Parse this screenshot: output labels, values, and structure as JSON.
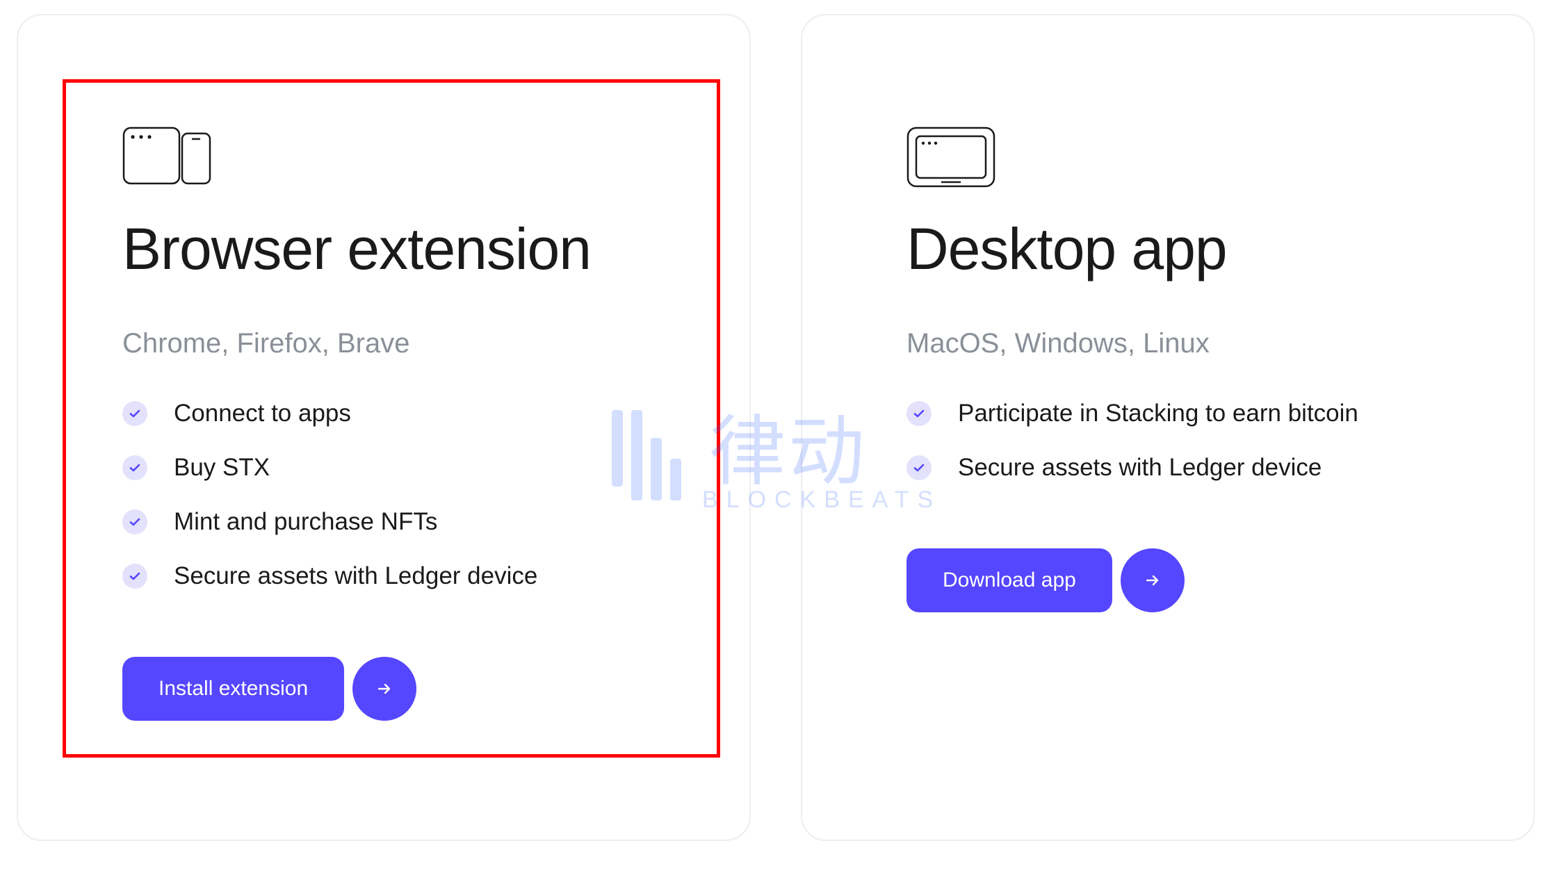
{
  "watermark": {
    "cn": "律动",
    "en": "BLOCKBEATS"
  },
  "cards": [
    {
      "icon": "browser-extension-icon",
      "title": "Browser extension",
      "subtitle": "Chrome, Firefox, Brave",
      "highlighted": true,
      "features": [
        "Connect to apps",
        "Buy STX",
        "Mint and purchase NFTs",
        "Secure assets with Ledger device"
      ],
      "cta_label": "Install extension"
    },
    {
      "icon": "desktop-app-icon",
      "title": "Desktop app",
      "subtitle": "MacOS, Windows, Linux",
      "highlighted": false,
      "features": [
        "Participate in Stacking to earn bitcoin",
        "Secure assets with Ledger device"
      ],
      "cta_label": "Download app"
    }
  ],
  "colors": {
    "accent": "#5546ff",
    "check_bg": "#e3e1fb",
    "border": "#eceef2",
    "muted": "#8a8f98",
    "highlight": "#ff0000"
  }
}
